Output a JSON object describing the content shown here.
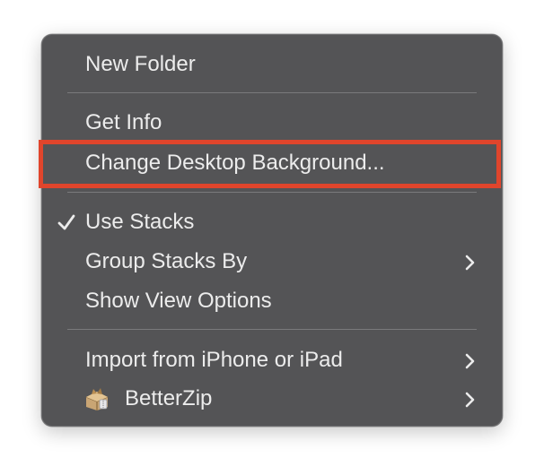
{
  "menu": {
    "items": {
      "new_folder": {
        "label": "New Folder"
      },
      "get_info": {
        "label": "Get Info"
      },
      "change_desktop_background": {
        "label": "Change Desktop Background..."
      },
      "use_stacks": {
        "label": "Use Stacks",
        "checked": true
      },
      "group_stacks_by": {
        "label": "Group Stacks By",
        "has_submenu": true
      },
      "show_view_options": {
        "label": "Show View Options"
      },
      "import_from_iphone": {
        "label": "Import from iPhone or iPad",
        "has_submenu": true
      },
      "betterzip": {
        "label": "BetterZip",
        "icon": "betterzip-app-icon",
        "has_submenu": true
      }
    }
  },
  "annotation": {
    "highlighted_item": "Change Desktop Background...",
    "color": "#e0452c"
  },
  "colors": {
    "menu_background": "#545456",
    "text": "#ececec",
    "separator": "#7a7a7c"
  }
}
